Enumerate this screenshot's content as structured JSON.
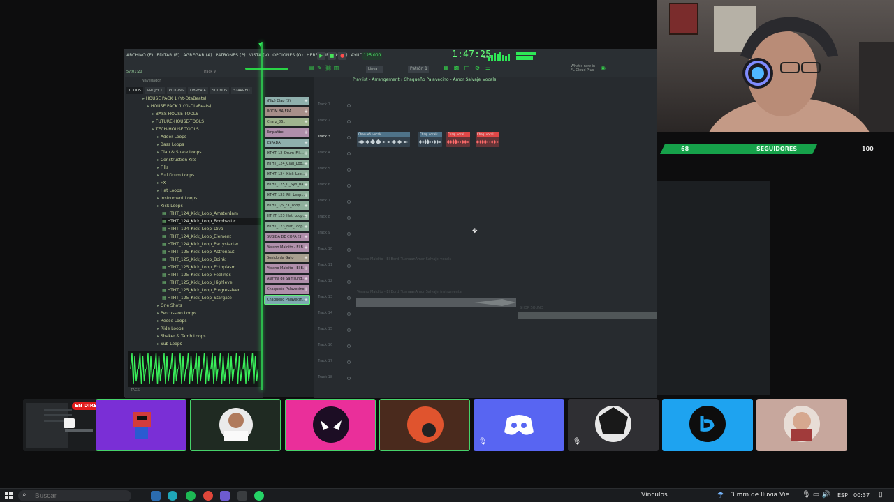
{
  "fl": {
    "menu": [
      "ARCHIVO (F)",
      "EDITAR (E)",
      "AGREGAR (A)",
      "PATRONES (P)",
      "VISTA (V)",
      "OPCIONES (O)",
      "HERRAMIENTAS (T)",
      "AYUDA"
    ],
    "hint": "57:01:20",
    "pattern_hint": "Track 9",
    "tempo": "125.000",
    "time": "1:47:25",
    "time_sub": "B:S:T",
    "news": "What's new in FL Cloud Plus",
    "line_select": "Línea",
    "pattern_select": "Patrón 1",
    "accent": "#2ee856"
  },
  "browser": {
    "label": "Navegador",
    "tabs": [
      "TODOS",
      "PROJECT",
      "PLUGINS",
      "LIBRERÍA",
      "SOUNDS",
      "STARRED"
    ],
    "tree": [
      {
        "label": "HOUSE PACK 1 (Yt-DtaBeats)",
        "type": "folder",
        "indent": 1
      },
      {
        "label": "HOUSE PACK 1 (Yt-DtaBeats)",
        "type": "folder",
        "indent": 2
      },
      {
        "label": "BASS HOUSE TOOLS",
        "type": "folder",
        "indent": 3
      },
      {
        "label": "FUTURE-HOUSE-TOOLS",
        "type": "folder",
        "indent": 3
      },
      {
        "label": "TECH-HOUSE TOOLS",
        "type": "folder",
        "indent": 3
      },
      {
        "label": "Adder Loops",
        "type": "folder",
        "indent": 4
      },
      {
        "label": "Bass Loops",
        "type": "folder",
        "indent": 4
      },
      {
        "label": "Clap & Snare Loops",
        "type": "folder",
        "indent": 4
      },
      {
        "label": "Construction Kits",
        "type": "folder",
        "indent": 4
      },
      {
        "label": "Fills",
        "type": "folder",
        "indent": 4
      },
      {
        "label": "Full Drum Loops",
        "type": "folder",
        "indent": 4
      },
      {
        "label": "FX",
        "type": "folder",
        "indent": 4
      },
      {
        "label": "Hat Loops",
        "type": "folder",
        "indent": 4
      },
      {
        "label": "Instrument Loops",
        "type": "folder",
        "indent": 4
      },
      {
        "label": "Kick Loops",
        "type": "folder",
        "indent": 4
      },
      {
        "label": "HTHT_124_Kick_Loop_Amsterdam",
        "type": "file",
        "indent": 5
      },
      {
        "label": "HTHT_124_Kick_Loop_Bombastic",
        "type": "file",
        "indent": 5,
        "selected": true
      },
      {
        "label": "HTHT_124_Kick_Loop_Diva",
        "type": "file",
        "indent": 5
      },
      {
        "label": "HTHT_124_Kick_Loop_Element",
        "type": "file",
        "indent": 5
      },
      {
        "label": "HTHT_124_Kick_Loop_Partystarter",
        "type": "file",
        "indent": 5
      },
      {
        "label": "HTHT_125_Kick_Loop_Astronaut",
        "type": "file",
        "indent": 5
      },
      {
        "label": "HTHT_125_Kick_Loop_Boink",
        "type": "file",
        "indent": 5
      },
      {
        "label": "HTHT_125_Kick_Loop_Ectoplasm",
        "type": "file",
        "indent": 5
      },
      {
        "label": "HTHT_125_Kick_Loop_Feelings",
        "type": "file",
        "indent": 5
      },
      {
        "label": "HTHT_125_Kick_Loop_Highlevel",
        "type": "file",
        "indent": 5
      },
      {
        "label": "HTHT_125_Kick_Loop_Progressiver",
        "type": "file",
        "indent": 5
      },
      {
        "label": "HTHT_125_Kick_Loop_Stargate",
        "type": "file",
        "indent": 5
      },
      {
        "label": "One Shots",
        "type": "folder",
        "indent": 4
      },
      {
        "label": "Percussion Loops",
        "type": "folder",
        "indent": 4
      },
      {
        "label": "Reese Loops",
        "type": "folder",
        "indent": 4
      },
      {
        "label": "Ride Loops",
        "type": "folder",
        "indent": 4
      },
      {
        "label": "Shaker & Tamb Loops",
        "type": "folder",
        "indent": 4
      },
      {
        "label": "Sub Loops",
        "type": "folder",
        "indent": 4
      }
    ],
    "footer": "TAGS"
  },
  "channels": [
    {
      "label": "(Flip) Clap (3)",
      "color": "#8fb0ad"
    },
    {
      "label": "BOOM BAJERA",
      "color": "#a78f8a"
    },
    {
      "label": "Charz_86...",
      "color": "#9fb48f"
    },
    {
      "label": "Empañbe",
      "color": "#b08fab"
    },
    {
      "label": "ESPADA",
      "color": "#8fb0ad"
    },
    {
      "label": "HTHT_12_Drum_Fill...",
      "color": "#8fb09c"
    },
    {
      "label": "HTHT_124_Clap_Loo...",
      "color": "#8fb09c"
    },
    {
      "label": "HTHT_124_Kick_Loo...",
      "color": "#8fb09c"
    },
    {
      "label": "HTHT_125_C_Syn_Ba...",
      "color": "#8fb09c"
    },
    {
      "label": "HTHT_123_Fill_Loop...",
      "color": "#8fb09c"
    },
    {
      "label": "HTHT_1/5_FX_Loop...",
      "color": "#8fb09c"
    },
    {
      "label": "HTHT_123_Hat_Loop...",
      "color": "#8fb09c"
    },
    {
      "label": "HTHT_123_Hat_Loop...",
      "color": "#8fb09c"
    },
    {
      "label": "SUBIDA DE COPA (3)",
      "color": "#b08fab"
    },
    {
      "label": "Verano Maldito - El B...",
      "color": "#b08fab"
    },
    {
      "label": "Sonido da Gato",
      "color": "#a89f8f"
    },
    {
      "label": "Verano Maldito - El B...",
      "color": "#b08fab"
    },
    {
      "label": "Alarma de Samsung...",
      "color": "#b08fab"
    },
    {
      "label": "Chaqueño Palavecino...",
      "color": "#b08fab"
    },
    {
      "label": "Chaqueño Palavecin...",
      "color": "#7fa9b0",
      "selected": true
    }
  ],
  "playlist": {
    "title": "Playlist - Arrangement › Chaqueño Palavecino - Amor Salvaje_vocals",
    "track_labels": [
      "Track 1",
      "Track 2",
      "Track 3",
      "Track 4",
      "Track 5",
      "Track 6",
      "Track 7",
      "Track 8",
      "Track 9",
      "Track 10",
      "Track 11",
      "Track 12",
      "Track 13",
      "Track 14",
      "Track 15",
      "Track 16",
      "Track 17",
      "Track 18"
    ],
    "active_track": "Track 3",
    "clips": [
      {
        "title": "Chaqueñ..vocals",
        "color": "#4f7389",
        "track": 3
      },
      {
        "title": "Chaq..vocals",
        "color": "#4f7389",
        "track": 3
      },
      {
        "title": "Chaq..vocal",
        "color": "#e04747",
        "track": 3
      },
      {
        "title": "Chaq..vocal",
        "color": "#e04747",
        "track": 3
      }
    ],
    "ghost_labels": [
      "Verano Maldito - El Bord_TuanaanAmor Salvaje_vocals",
      "Verano Maldito - El Bord_TuanaanAmor Salvaje_instrumental",
      "SHOP SOUND"
    ]
  },
  "followers": {
    "current": "68",
    "label": "SEGUIDORES",
    "goal": "100"
  },
  "cards": {
    "live_badge": "EN DIRECTO",
    "colors": [
      "#7a2fd6",
      "#1f2a22",
      "#ea2f9a",
      "#4a2a1d",
      "#5865f2",
      "#2f2f33",
      "#1ea3f0",
      "#c7a79d"
    ]
  },
  "taskbar": {
    "search_placeholder": "Buscar",
    "links": "Vínculos",
    "weather": "3 mm de lluvia Vie",
    "lang": "ESP",
    "clock": "00:37"
  }
}
